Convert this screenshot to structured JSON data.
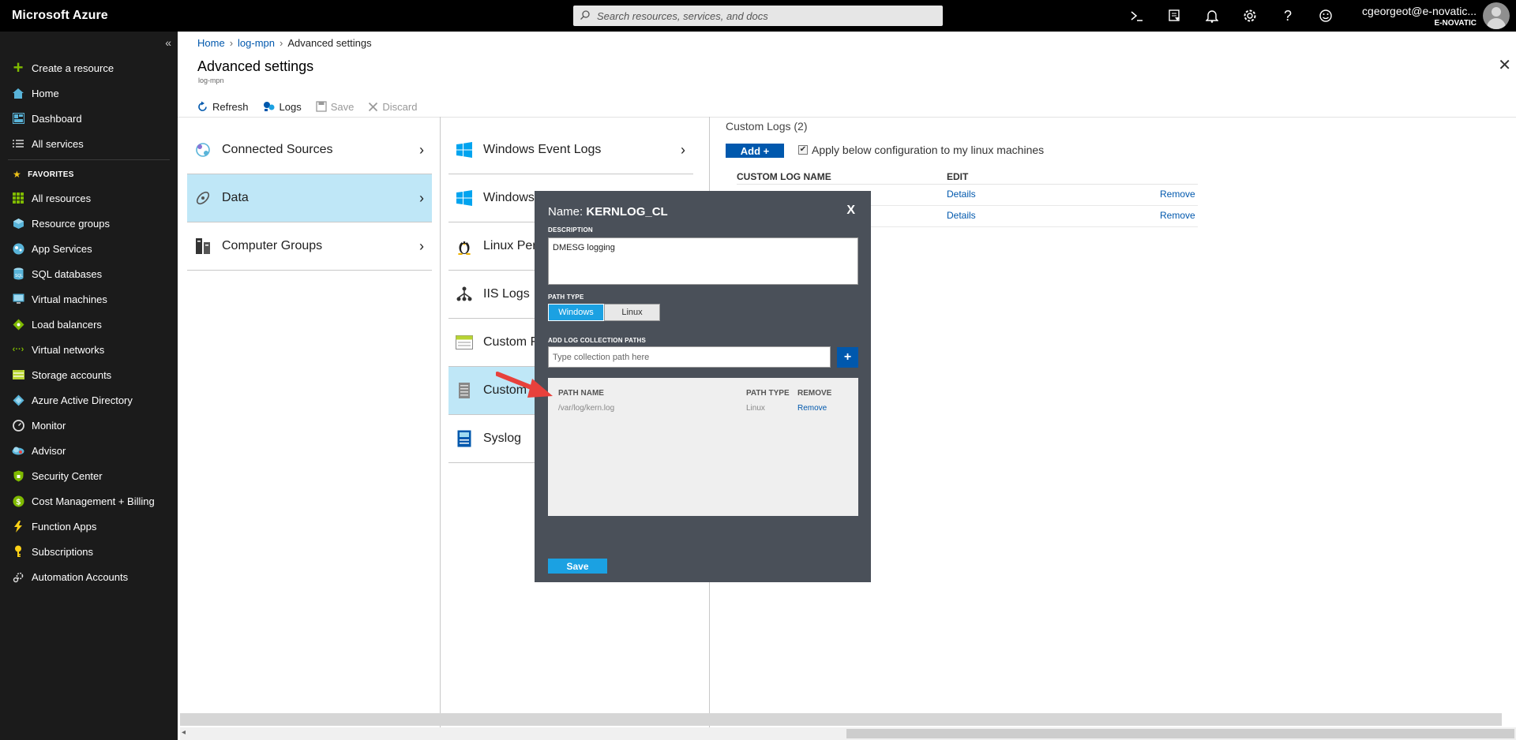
{
  "topbar": {
    "brand": "Microsoft Azure",
    "search_placeholder": "Search resources, services, and docs",
    "user_email": "cgeorgeot@e-novatic...",
    "user_org": "E-NOVATIC",
    "icons": [
      "cloud-shell-icon",
      "directory-filter-icon",
      "notifications-icon",
      "settings-icon",
      "help-icon",
      "feedback-icon"
    ]
  },
  "sidebar": {
    "collapse": "«",
    "create": "Create a resource",
    "items_top": [
      {
        "label": "Home",
        "icon": "home-icon"
      },
      {
        "label": "Dashboard",
        "icon": "dashboard-icon"
      },
      {
        "label": "All services",
        "icon": "all-services-icon"
      }
    ],
    "favorites_label": "FAVORITES",
    "favorites": [
      {
        "label": "All resources",
        "icon": "all-resources-icon",
        "color": "#7fba00"
      },
      {
        "label": "Resource groups",
        "icon": "resource-groups-icon",
        "color": "#59b4d9"
      },
      {
        "label": "App Services",
        "icon": "app-services-icon",
        "color": "#59b4d9"
      },
      {
        "label": "SQL databases",
        "icon": "sql-databases-icon",
        "color": "#59b4d9"
      },
      {
        "label": "Virtual machines",
        "icon": "virtual-machines-icon",
        "color": "#59b4d9"
      },
      {
        "label": "Load balancers",
        "icon": "load-balancers-icon",
        "color": "#7fba00"
      },
      {
        "label": "Virtual networks",
        "icon": "virtual-networks-icon",
        "color": "#7fba00"
      },
      {
        "label": "Storage accounts",
        "icon": "storage-accounts-icon",
        "color": "#b8d432"
      },
      {
        "label": "Azure Active Directory",
        "icon": "aad-icon",
        "color": "#59b4d9"
      },
      {
        "label": "Monitor",
        "icon": "monitor-icon",
        "color": "#ffffff"
      },
      {
        "label": "Advisor",
        "icon": "advisor-icon",
        "color": "#59b4d9"
      },
      {
        "label": "Security Center",
        "icon": "security-center-icon",
        "color": "#7fba00"
      },
      {
        "label": "Cost Management + Billing",
        "icon": "cost-management-icon",
        "color": "#7fba00"
      },
      {
        "label": "Function Apps",
        "icon": "function-apps-icon",
        "color": "#fcd116"
      },
      {
        "label": "Subscriptions",
        "icon": "subscriptions-icon",
        "color": "#fcd116"
      },
      {
        "label": "Automation Accounts",
        "icon": "automation-accounts-icon",
        "color": "#ffffff"
      }
    ]
  },
  "breadcrumb": [
    "Home",
    "log-mpn",
    "Advanced settings"
  ],
  "blade": {
    "title": "Advanced settings",
    "subtitle": "log-mpn",
    "toolbar": {
      "refresh": "Refresh",
      "logs": "Logs",
      "save": "Save",
      "discard": "Discard"
    }
  },
  "col1": [
    {
      "label": "Connected Sources",
      "icon": "connected-sources-icon"
    },
    {
      "label": "Data",
      "icon": "data-icon",
      "selected": true
    },
    {
      "label": "Computer Groups",
      "icon": "computer-groups-icon"
    }
  ],
  "col2": [
    {
      "label": "Windows Event Logs",
      "icon": "windows-icon"
    },
    {
      "label": "Windows Performance Counters",
      "icon": "windows-icon"
    },
    {
      "label": "Linux Performance Counters",
      "icon": "linux-icon"
    },
    {
      "label": "IIS Logs",
      "icon": "iis-icon"
    },
    {
      "label": "Custom Fields",
      "icon": "custom-fields-icon"
    },
    {
      "label": "Custom Logs",
      "icon": "custom-logs-icon",
      "selected": true
    },
    {
      "label": "Syslog",
      "icon": "syslog-icon"
    }
  ],
  "custom_logs": {
    "title": "Custom Logs (2)",
    "add": "Add +",
    "apply_label": "Apply below configuration to my linux machines",
    "apply_checked": true,
    "col_name": "CUSTOM LOG NAME",
    "col_edit": "EDIT",
    "rows": [
      {
        "details": "Details",
        "remove": "Remove"
      },
      {
        "details": "Details",
        "remove": "Remove"
      }
    ]
  },
  "dialog": {
    "name_prefix": "Name:",
    "name": "KERNLOG_CL",
    "close": "X",
    "description_label": "DESCRIPTION",
    "description": "DMESG logging",
    "path_type_label": "PATH TYPE",
    "path_type_windows": "Windows",
    "path_type_linux": "Linux",
    "add_paths_label": "ADD LOG COLLECTION PATHS",
    "path_placeholder": "Type collection path here",
    "plus": "+",
    "table_path_name": "PATH NAME",
    "table_path_type": "PATH TYPE",
    "table_remove": "REMOVE",
    "paths": [
      {
        "name": "/var/log/kern.log",
        "type": "Linux",
        "remove": "Remove"
      }
    ],
    "save": "Save"
  },
  "colors": {
    "accent": "#0058ad",
    "selected_bg": "#bfe7f7",
    "dialog_bg": "#4a5059",
    "toggle_on": "#1ba1e2",
    "arrow": "#e8413c"
  }
}
